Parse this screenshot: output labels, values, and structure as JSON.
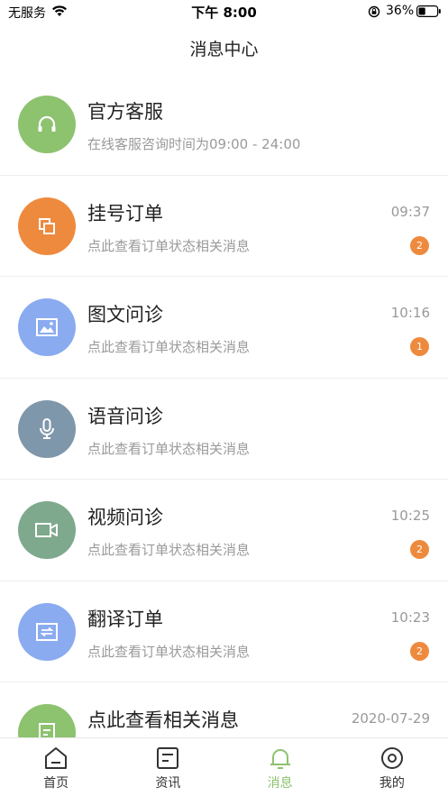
{
  "status_bar": {
    "carrier": "无服务",
    "time": "下午 8:00",
    "battery": "36%"
  },
  "nav": {
    "title": "消息中心"
  },
  "colors": {
    "green": "#8dc26f",
    "orange": "#ee8a3e",
    "blue": "#8aabf0",
    "slate": "#7f97ab",
    "sage": "#7ea98d",
    "badge": "#ee8a3e"
  },
  "messages": [
    {
      "title": "官方客服",
      "subtitle": "在线客服咨询时间为09:00 - 24:00",
      "time": "",
      "badge": "",
      "icon": "headset-icon",
      "color": "#8dc26f"
    },
    {
      "title": "挂号订单",
      "subtitle": "点此查看订单状态相关消息",
      "time": "09:37",
      "badge": "2",
      "icon": "copy-icon",
      "color": "#ee8a3e"
    },
    {
      "title": "图文问诊",
      "subtitle": "点此查看订单状态相关消息",
      "time": "10:16",
      "badge": "1",
      "icon": "image-icon",
      "color": "#8aabf0"
    },
    {
      "title": "语音问诊",
      "subtitle": "点此查看订单状态相关消息",
      "time": "",
      "badge": "",
      "icon": "microphone-icon",
      "color": "#7f97ab"
    },
    {
      "title": "视频问诊",
      "subtitle": "点此查看订单状态相关消息",
      "time": "10:25",
      "badge": "2",
      "icon": "video-camera-icon",
      "color": "#7ea98d"
    },
    {
      "title": "翻译订单",
      "subtitle": "点此查看订单状态相关消息",
      "time": "10:23",
      "badge": "2",
      "icon": "translate-icon",
      "color": "#8aabf0"
    },
    {
      "title": "点此查看相关消息",
      "subtitle": "",
      "time": "2020-07-29",
      "badge": "",
      "icon": "document-icon",
      "color": "#8dc26f"
    }
  ],
  "tabs": [
    {
      "label": "首页",
      "icon": "home-icon",
      "active": false
    },
    {
      "label": "资讯",
      "icon": "news-icon",
      "active": false
    },
    {
      "label": "消息",
      "icon": "bell-icon",
      "active": true
    },
    {
      "label": "我的",
      "icon": "profile-icon",
      "active": false
    }
  ]
}
